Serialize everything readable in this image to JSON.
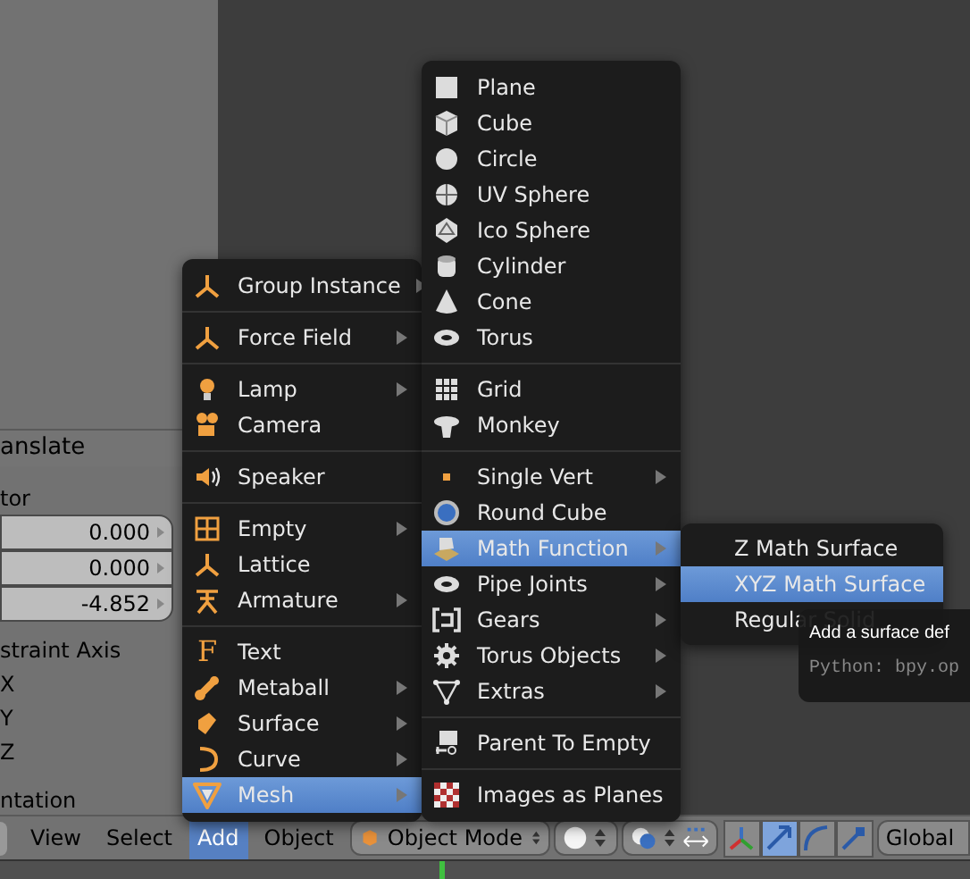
{
  "properties_panel": {
    "title": "anslate",
    "vector_label": "tor",
    "fields": [
      "0.000",
      "0.000",
      "-4.852"
    ],
    "constraint_label": "straint Axis",
    "axes": [
      {
        "label": "X"
      },
      {
        "label": "Y"
      },
      {
        "label": "Z"
      }
    ],
    "orientation_label": "ntation"
  },
  "add_menu": {
    "sections": [
      [
        {
          "label": "Group Instance",
          "submenu": true,
          "selected": false
        }
      ],
      [
        {
          "label": "Force Field",
          "submenu": true,
          "selected": false
        }
      ],
      [
        {
          "label": "Lamp",
          "submenu": true,
          "selected": false
        },
        {
          "label": "Camera",
          "submenu": false,
          "selected": false
        }
      ],
      [
        {
          "label": "Speaker",
          "submenu": false,
          "selected": false
        }
      ],
      [
        {
          "label": "Empty",
          "submenu": true,
          "selected": false
        },
        {
          "label": "Lattice",
          "submenu": false,
          "selected": false
        },
        {
          "label": "Armature",
          "submenu": true,
          "selected": false
        }
      ],
      [
        {
          "label": "Text",
          "submenu": false,
          "selected": false,
          "glyph": "F"
        },
        {
          "label": "Metaball",
          "submenu": true,
          "selected": false
        },
        {
          "label": "Surface",
          "submenu": true,
          "selected": false
        },
        {
          "label": "Curve",
          "submenu": true,
          "selected": false
        },
        {
          "label": "Mesh",
          "submenu": true,
          "selected": true
        }
      ]
    ]
  },
  "mesh_menu": {
    "sections": [
      [
        {
          "label": "Plane",
          "submenu": false,
          "selected": false
        },
        {
          "label": "Cube",
          "submenu": false,
          "selected": false
        },
        {
          "label": "Circle",
          "submenu": false,
          "selected": false
        },
        {
          "label": "UV Sphere",
          "submenu": false,
          "selected": false
        },
        {
          "label": "Ico Sphere",
          "submenu": false,
          "selected": false
        },
        {
          "label": "Cylinder",
          "submenu": false,
          "selected": false
        },
        {
          "label": "Cone",
          "submenu": false,
          "selected": false
        },
        {
          "label": "Torus",
          "submenu": false,
          "selected": false
        }
      ],
      [
        {
          "label": "Grid",
          "submenu": false,
          "selected": false
        },
        {
          "label": "Monkey",
          "submenu": false,
          "selected": false
        }
      ],
      [
        {
          "label": "Single Vert",
          "submenu": true,
          "selected": false
        },
        {
          "label": "Round Cube",
          "submenu": false,
          "selected": false
        },
        {
          "label": "Math Function",
          "submenu": true,
          "selected": true
        },
        {
          "label": "Pipe Joints",
          "submenu": true,
          "selected": false
        },
        {
          "label": "Gears",
          "submenu": true,
          "selected": false
        },
        {
          "label": "Torus Objects",
          "submenu": true,
          "selected": false
        },
        {
          "label": "Extras",
          "submenu": true,
          "selected": false
        }
      ],
      [
        {
          "label": "Parent To Empty",
          "submenu": false,
          "selected": false
        }
      ],
      [
        {
          "label": "Images as Planes",
          "submenu": false,
          "selected": false
        }
      ]
    ]
  },
  "math_menu": {
    "items": [
      {
        "label": "Z Math Surface",
        "selected": false
      },
      {
        "label": "XYZ Math Surface",
        "selected": true
      },
      {
        "label": "Regular Solid",
        "selected": false
      }
    ]
  },
  "tooltip": {
    "text": "Add a surface def",
    "python": "Python: bpy.op"
  },
  "header": {
    "menus": [
      {
        "label": "View",
        "selected": false
      },
      {
        "label": "Select",
        "selected": false
      },
      {
        "label": "Add",
        "selected": true
      },
      {
        "label": "Object",
        "selected": false
      }
    ],
    "mode": "Object Mode",
    "manipulators": [
      {
        "selected": false
      },
      {
        "selected": true
      },
      {
        "selected": false
      },
      {
        "selected": false
      }
    ],
    "orientation": "Global"
  }
}
